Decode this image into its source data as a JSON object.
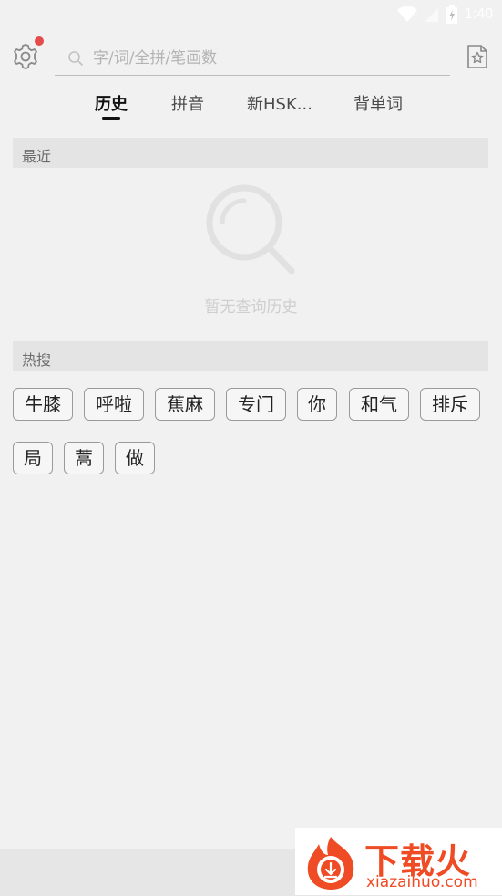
{
  "status_bar": {
    "time": "1:40"
  },
  "header": {
    "search_placeholder": "字/词/全拼/笔画数",
    "settings_icon": "gear-icon",
    "favorites_icon": "star-file-icon"
  },
  "tabs": [
    {
      "label": "历史",
      "active": true
    },
    {
      "label": "拼音",
      "active": false
    },
    {
      "label": "新HSK...",
      "active": false
    },
    {
      "label": "背单词",
      "active": false
    }
  ],
  "recent": {
    "title": "最近",
    "empty_text": "暂无查询历史"
  },
  "hot": {
    "title": "热搜",
    "items": [
      "牛膝",
      "呼啦",
      "蕉麻",
      "专门",
      "你",
      "和气",
      "排斥",
      "局",
      "蒿",
      "做"
    ]
  },
  "watermark": {
    "title": "下载火",
    "subtitle": "xiazaihuo.com"
  },
  "colors": {
    "accent_dot": "#e54b4b",
    "watermark": "#ef4b24"
  }
}
